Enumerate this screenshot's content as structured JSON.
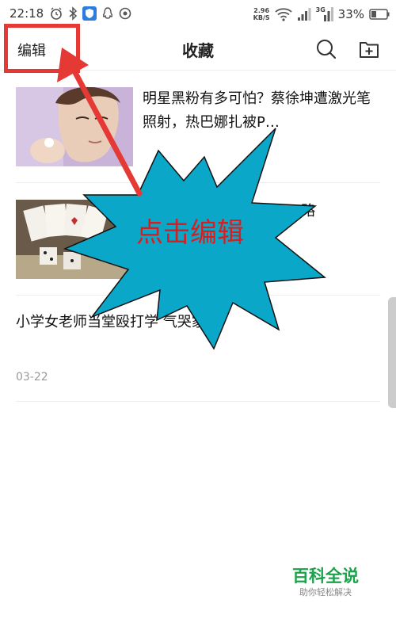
{
  "status_bar": {
    "time": "22:18",
    "net_speed_value": "2.96",
    "net_speed_unit": "KB/S",
    "sim2_label": "3G",
    "battery": "33%"
  },
  "header": {
    "edit_label": "编辑",
    "title": "收藏"
  },
  "news": [
    {
      "title": "明星黑粉有多可怕？蔡徐坤遭激光笔照射，热巴娜扎被P…"
    },
    {
      "title": "略"
    },
    {
      "title": "小学女老师当堂殴打学        气哭家长",
      "date": "03-22"
    }
  ],
  "annotation": {
    "text": "点击编辑"
  },
  "watermark": {
    "title": "百科全说",
    "subtitle": "助你轻松解决"
  },
  "colors": {
    "annotation_red": "#e53935",
    "burst_fill": "#0aa7c9",
    "watermark_green": "#1aa34a"
  }
}
